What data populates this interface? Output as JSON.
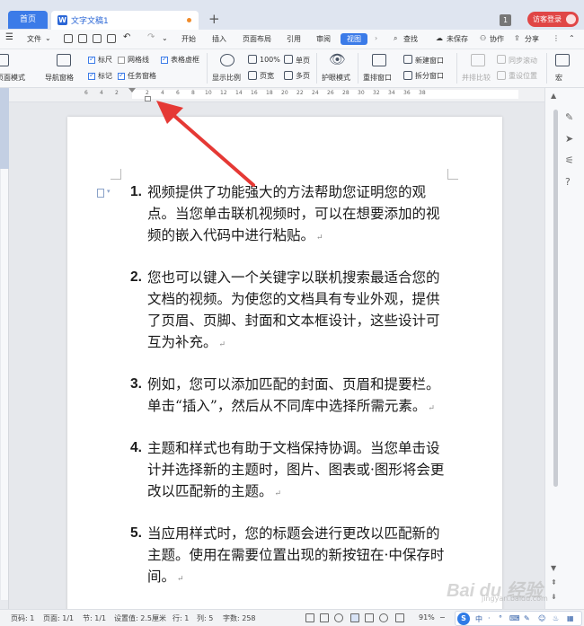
{
  "titlebar": {
    "home_tab": "首页",
    "doc_tab": "文字文稿1",
    "window_count": "1",
    "visitor_login": "访客登录"
  },
  "menubar": {
    "file": "文件",
    "tabs": [
      "开始",
      "插入",
      "页面布局",
      "引用",
      "审阅",
      "视图"
    ],
    "active_tab": "视图",
    "search": "查找",
    "unsaved": "未保存",
    "collaborate": "协作",
    "share": "分享"
  },
  "ribbon": {
    "page_mode": "页面模式",
    "nav_pane": "导航窗格",
    "ruler": "标尺",
    "gridlines": "网格线",
    "table_borders": "表格虚框",
    "marks": "标记",
    "task_pane": "任务窗格",
    "zoom": "显示比例",
    "zoom_100": "100%",
    "page_width": "页宽",
    "single_page": "单页",
    "multi_page": "多页",
    "eye_mode": "护眼模式",
    "rearrange": "重排窗口",
    "new_window": "新建窗口",
    "split_window": "拆分窗口",
    "side_by_side": "并排比较",
    "sync_scroll": "同步滚动",
    "reset_position": "重设位置",
    "macro": "宏"
  },
  "ruler": {
    "ticks": [
      "6",
      "4",
      "2",
      "2",
      "4",
      "6",
      "8",
      "10",
      "12",
      "14",
      "16",
      "18",
      "20",
      "22",
      "24",
      "26",
      "28",
      "30",
      "32",
      "34",
      "36",
      "38"
    ]
  },
  "document": {
    "items": [
      {
        "num": "1.",
        "text": "视频提供了功能强大的方法帮助您证明您的观点。当您单击联机视频时，可以在想要添加的视频的嵌入代码中进行粘贴。"
      },
      {
        "num": "2.",
        "text": "您也可以键入一个关键字以联机搜索最适合您的文档的视频。为使您的文档具有专业外观，提供了页眉、页脚、封面和文本框设计，这些设计可互为补充。"
      },
      {
        "num": "3.",
        "text": "例如，您可以添加匹配的封面、页眉和提要栏。单击“插入”，然后从不同库中选择所需元素。"
      },
      {
        "num": "4.",
        "text": "主题和样式也有助于文档保持协调。当您单击设计并选择新的主题时，图片、图表或·图形将会更改以匹配新的主题。"
      },
      {
        "num": "5.",
        "text": "当应用样式时，您的标题会进行更改以匹配新的主题。使用在需要位置出现的新按钮在·中保存时间。"
      }
    ],
    "para_mark": "↵"
  },
  "statusbar": {
    "page_num": "页码: 1",
    "page_count": "页面: 1/1",
    "section": "节: 1/1",
    "setting": "设置值: 2.5厘米",
    "row": "行: 1",
    "col": "列: 5",
    "word_count": "字数: 258",
    "zoom": "91%"
  },
  "ime": {
    "logo": "S",
    "glyphs": [
      "中",
      "·",
      "°",
      "⌨",
      "✎",
      "☺",
      "♨",
      "▦"
    ]
  },
  "watermark": {
    "brand": "Bai du 经验",
    "sub": "jingyan.baidu.com"
  },
  "colors": {
    "accent": "#3b7be8",
    "visitor_red": "#e04646",
    "arrow_red": "#e53935",
    "unsaved_dot": "#f08b2a"
  },
  "icons": {
    "tab_doc": "w-doc-icon",
    "home": "home-tab",
    "search": "search-icon",
    "annotation": "red-arrow-annotation"
  }
}
